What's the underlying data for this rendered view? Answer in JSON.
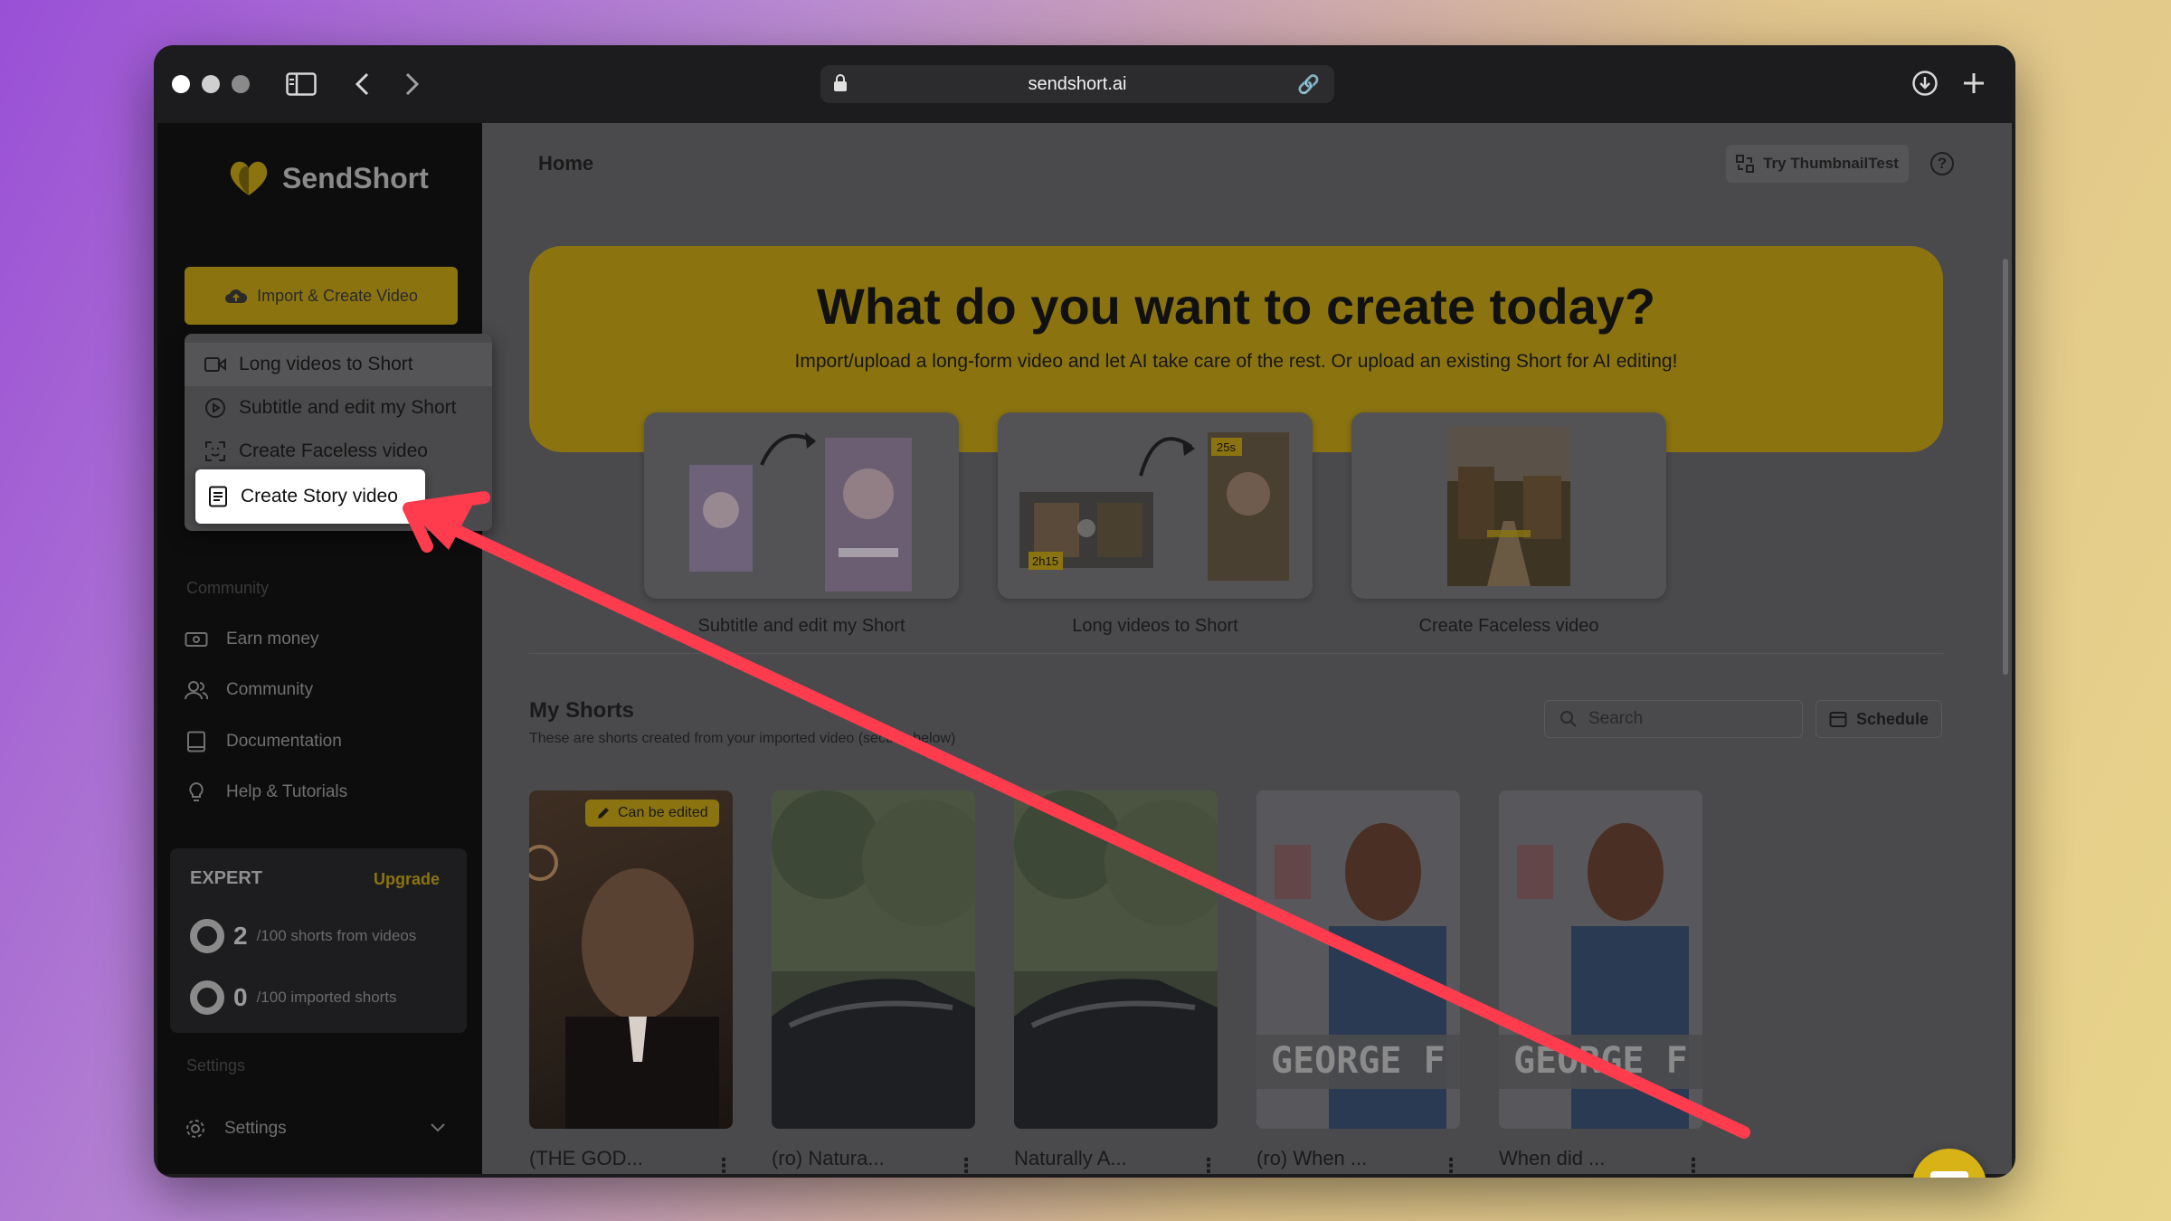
{
  "browser": {
    "url": "sendshort.ai",
    "colors": {
      "red": "#ff5f57",
      "gray": "#8a8a8a"
    }
  },
  "sidebar": {
    "brand": "SendShort",
    "import_button": "Import & Create Video",
    "dropdown": [
      {
        "label": "Long videos to Short",
        "icon": "video-camera-icon"
      },
      {
        "label": "Subtitle and edit my Short",
        "icon": "play-circle-icon"
      },
      {
        "label": "Create Faceless video",
        "icon": "face-scan-icon"
      },
      {
        "label": "Create Story video",
        "icon": "document-icon"
      }
    ],
    "section_community": "Community",
    "nav": [
      {
        "label": "Earn money",
        "icon": "money-icon"
      },
      {
        "label": "Community",
        "icon": "users-icon"
      },
      {
        "label": "Documentation",
        "icon": "book-icon"
      },
      {
        "label": "Help & Tutorials",
        "icon": "lightbulb-icon"
      }
    ],
    "plan": {
      "name": "EXPERT",
      "upgrade": "Upgrade",
      "rows": [
        {
          "value": "2",
          "desc": "/100 shorts from videos"
        },
        {
          "value": "0",
          "desc": "/100 imported shorts"
        }
      ]
    },
    "section_settings": "Settings",
    "settings": "Settings"
  },
  "header": {
    "title": "Home",
    "thumbnail_button": "Try ThumbnailTest",
    "help": "?"
  },
  "hero": {
    "heading": "What do you want to create today?",
    "subheading": "Import/upload a long-form video and let AI take care of the rest. Or upload an existing Short for AI editing!",
    "cards": [
      {
        "label": "Subtitle and edit my Short"
      },
      {
        "label": "Long videos to Short",
        "badge_long": "2h15",
        "badge_short": "25s"
      },
      {
        "label": "Create Faceless video"
      }
    ]
  },
  "shorts": {
    "heading": "My Shorts",
    "subheading": "These are shorts created from your imported video (section below)",
    "search_placeholder": "Search",
    "schedule": "Schedule",
    "edit_badge": "Can be edited",
    "items": [
      {
        "title": "(THE GOD..."
      },
      {
        "title": "(ro) Natura..."
      },
      {
        "title": "Naturally A..."
      },
      {
        "title": "(ro) When ...",
        "caption": "GEORGE F"
      },
      {
        "title": "When did ...",
        "caption": "GEORGE F"
      }
    ]
  },
  "accent_color": "#d8b318",
  "arrow_color": "#ff3b4e"
}
